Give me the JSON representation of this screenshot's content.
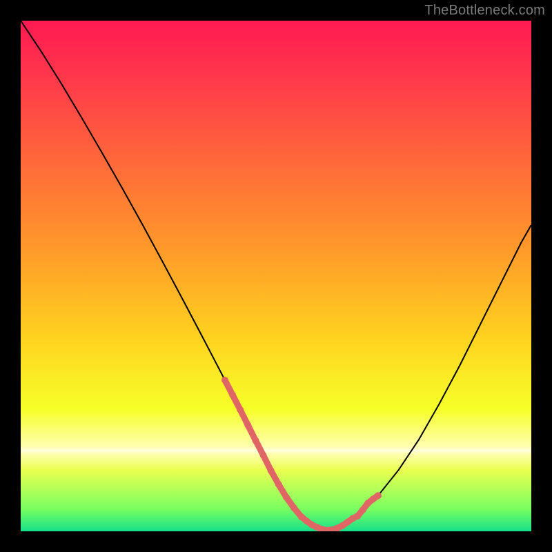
{
  "watermark": "TheBottleneck.com",
  "colors": {
    "page_bg": "#000000",
    "watermark": "#7b7b7b",
    "curve": "#000000",
    "overlay_marker": "#e06666",
    "gradient_stops": [
      {
        "offset": 0.0,
        "color": "#ff1a52"
      },
      {
        "offset": 0.12,
        "color": "#ff3a4a"
      },
      {
        "offset": 0.28,
        "color": "#ff6a3a"
      },
      {
        "offset": 0.45,
        "color": "#ff9a2a"
      },
      {
        "offset": 0.62,
        "color": "#ffd21f"
      },
      {
        "offset": 0.76,
        "color": "#f6ff28"
      },
      {
        "offset": 0.835,
        "color": "#ffffb0"
      },
      {
        "offset": 0.842,
        "color": "#ffffe0"
      },
      {
        "offset": 0.848,
        "color": "#ffffb0"
      },
      {
        "offset": 0.88,
        "color": "#eaff50"
      },
      {
        "offset": 0.955,
        "color": "#7bff60"
      },
      {
        "offset": 1.0,
        "color": "#16e08a"
      }
    ]
  },
  "chart_data": {
    "type": "line",
    "title": "",
    "xlabel": "",
    "ylabel": "",
    "xlim": [
      0,
      100
    ],
    "ylim": [
      0,
      100
    ],
    "grid": false,
    "legend": false,
    "series": [
      {
        "name": "bottleneck-curve",
        "x": [
          0,
          4,
          8,
          12,
          16,
          20,
          24,
          28,
          32,
          36,
          40,
          44,
          48,
          50,
          52,
          54,
          56,
          58,
          60,
          62,
          66,
          70,
          74,
          78,
          82,
          86,
          90,
          94,
          98,
          100
        ],
        "y": [
          100,
          94.0,
          87.6,
          80.9,
          74.0,
          67.0,
          59.8,
          52.4,
          44.9,
          37.3,
          29.6,
          21.8,
          13.9,
          10.0,
          6.7,
          4.0,
          2.0,
          0.8,
          0.2,
          0.6,
          3.0,
          7.0,
          12.0,
          18.0,
          25.0,
          32.5,
          40.5,
          48.5,
          56.5,
          60.0
        ]
      }
    ],
    "overlay_markers": {
      "name": "highlight-segment",
      "x": [
        40,
        41.5,
        43,
        44.5,
        46,
        47.5,
        49,
        50.5,
        52,
        53.5,
        55,
        56,
        57,
        58,
        59,
        60,
        61,
        62,
        63,
        64,
        65,
        66,
        67,
        68,
        69,
        70
      ],
      "y": [
        29.6,
        26.7,
        23.8,
        20.8,
        17.8,
        14.9,
        11.9,
        9.2,
        6.7,
        4.6,
        2.8,
        2.0,
        1.3,
        0.8,
        0.4,
        0.2,
        0.3,
        0.6,
        1.1,
        1.8,
        2.5,
        3.0,
        4.2,
        5.5,
        6.3,
        7.0
      ]
    }
  }
}
